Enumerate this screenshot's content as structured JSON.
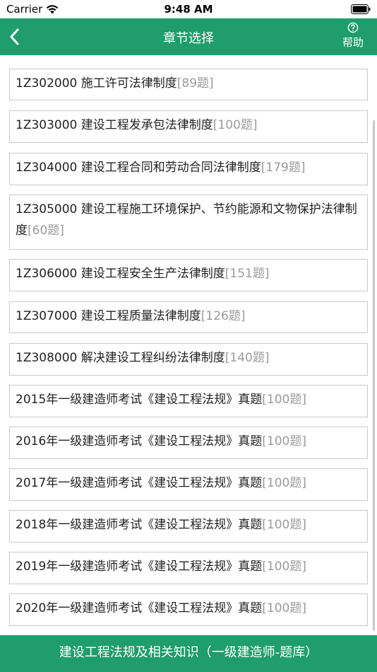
{
  "status": {
    "carrier": "Carrier",
    "time": "9:48 AM"
  },
  "nav": {
    "title": "章节选择",
    "help_label": "帮助"
  },
  "chapters": [
    {
      "title": "1Z302000 施工许可法律制度",
      "count": "[89题]"
    },
    {
      "title": "1Z303000 建设工程发承包法律制度",
      "count": "[100题]"
    },
    {
      "title": "1Z304000 建设工程合同和劳动合同法律制度",
      "count": "[179题]"
    },
    {
      "title": "1Z305000 建设工程施工环境保护、节约能源和文物保护法律制度",
      "count": "[60题]"
    },
    {
      "title": "1Z306000 建设工程安全生产法律制度",
      "count": "[151题]"
    },
    {
      "title": "1Z307000 建设工程质量法律制度",
      "count": "[126题]"
    },
    {
      "title": "1Z308000 解决建设工程纠纷法律制度",
      "count": "[140题]"
    },
    {
      "title": "2015年一级建造师考试《建设工程法规》真题",
      "count": "[100题]"
    },
    {
      "title": "2016年一级建造师考试《建设工程法规》真题",
      "count": "[100题]"
    },
    {
      "title": "2017年一级建造师考试《建设工程法规》真题",
      "count": "[100题]"
    },
    {
      "title": "2018年一级建造师考试《建设工程法规》真题",
      "count": "[100题]"
    },
    {
      "title": "2019年一级建造师考试《建设工程法规》真题",
      "count": "[100题]"
    },
    {
      "title": "2020年一级建造师考试《建设工程法规》真题",
      "count": "[100题]"
    }
  ],
  "footer": {
    "title": "建设工程法规及相关知识（一级建造师-题库）"
  },
  "colors": {
    "accent": "#1f9d6c",
    "count_text": "#9a9a9a",
    "border": "#c9c9c9"
  },
  "icons": {
    "back": "chevron-left-icon",
    "help": "question-circle-icon",
    "wifi": "wifi-icon",
    "battery": "battery-icon"
  }
}
